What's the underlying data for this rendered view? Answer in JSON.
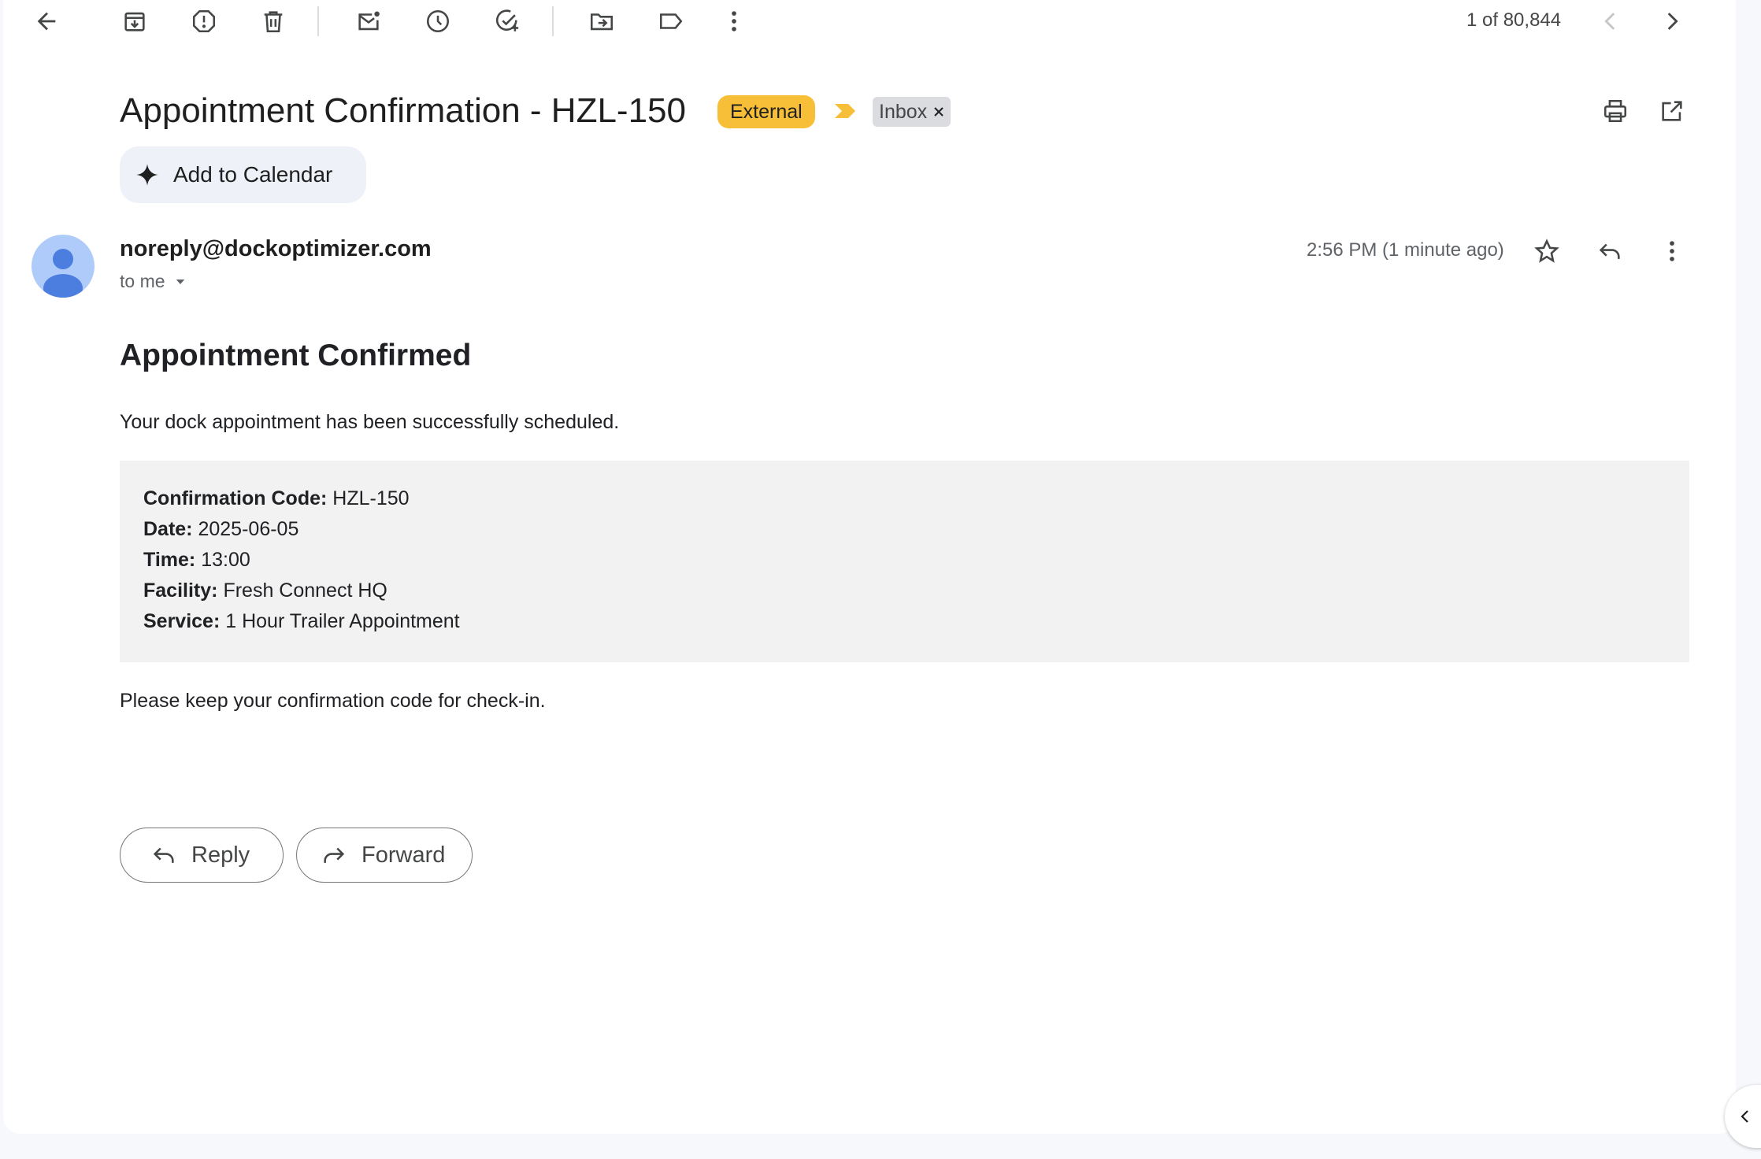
{
  "toolbar": {
    "counter": "1 of 80,844",
    "icons": [
      "back-arrow-icon",
      "archive-icon",
      "report-spam-icon",
      "delete-icon",
      "mark-unread-icon",
      "snooze-icon",
      "add-task-icon",
      "move-to-icon",
      "labels-icon",
      "more-vert-icon",
      "chevron-left-icon",
      "chevron-right-icon"
    ]
  },
  "email": {
    "subject": "Appointment Confirmation - HZL-150",
    "labels": {
      "external": "External",
      "inbox": "Inbox"
    },
    "add_to_calendar": "Add to Calendar",
    "sender": "noreply@dockoptimizer.com",
    "to": "to me",
    "time": "2:56 PM (1 minute ago)"
  },
  "body": {
    "heading": "Appointment Confirmed",
    "intro": "Your dock appointment has been successfully scheduled.",
    "details": [
      {
        "label": "Confirmation Code:",
        "value": "HZL-150"
      },
      {
        "label": "Date:",
        "value": "2025-06-05"
      },
      {
        "label": "Time:",
        "value": "13:00"
      },
      {
        "label": "Facility:",
        "value": "Fresh Connect HQ"
      },
      {
        "label": "Service:",
        "value": "1 Hour Trailer Appointment"
      }
    ],
    "outro": "Please keep your confirmation code for check-in."
  },
  "actions": {
    "reply": "Reply",
    "forward": "Forward"
  },
  "colors": {
    "external_badge": "#f6bf37",
    "inbox_badge": "#dadce0",
    "details_bg": "#f2f2f2",
    "avatar_bg": "#aecbfa",
    "avatar_fg": "#4c7ee0"
  }
}
